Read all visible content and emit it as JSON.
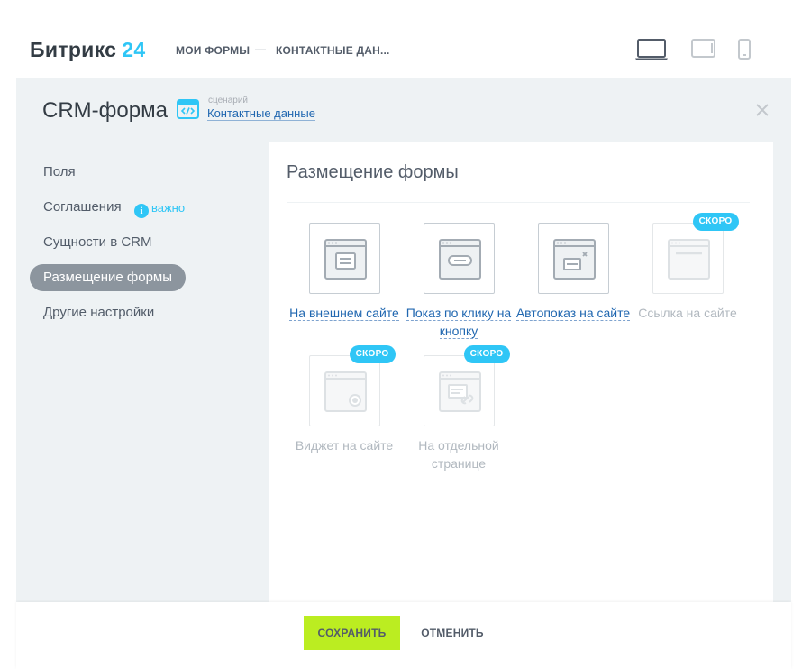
{
  "header": {
    "logo_text": "Битрикс",
    "logo_number": "24",
    "breadcrumb": [
      "Мои формы",
      "Контактные дан..."
    ],
    "separator": "—",
    "device_icons": [
      "laptop-icon",
      "tablet-icon",
      "phone-icon"
    ]
  },
  "panel": {
    "title": "CRM-форма",
    "scenario_label": "сценарий",
    "scenario_link": "Контактные данные",
    "close_icon": "close-icon"
  },
  "sidebar": {
    "items": [
      {
        "label": "Поля"
      },
      {
        "label": "Соглашения",
        "badge": "важно"
      },
      {
        "label": "Сущности в CRM"
      },
      {
        "label": "Размещение формы",
        "active": true
      },
      {
        "label": "Другие настройки"
      }
    ]
  },
  "content": {
    "title": "Размещение формы",
    "soon_label": "скоро",
    "tiles": [
      {
        "label": "На внешнем сайте",
        "icon": "embedded-form-icon",
        "enabled": true
      },
      {
        "label": "Показ по клику на кнопку",
        "icon": "button-click-icon",
        "enabled": true
      },
      {
        "label": "Автопоказ на сайте",
        "icon": "autoshow-icon",
        "enabled": true
      },
      {
        "label": "Ссылка на сайте",
        "icon": "link-icon",
        "enabled": false
      },
      {
        "label": "Виджет на сайте",
        "icon": "widget-icon",
        "enabled": false
      },
      {
        "label": "На отдельной странице",
        "icon": "separate-page-icon",
        "enabled": false
      }
    ]
  },
  "footer": {
    "save_label": "Сохранить",
    "cancel_label": "Отменить"
  },
  "colors": {
    "accent_blue": "#2fc6f6",
    "link_blue": "#2067b0",
    "save_green": "#bbed21",
    "active_menu": "#8c959e",
    "panel_bg": "#eef2f4"
  }
}
